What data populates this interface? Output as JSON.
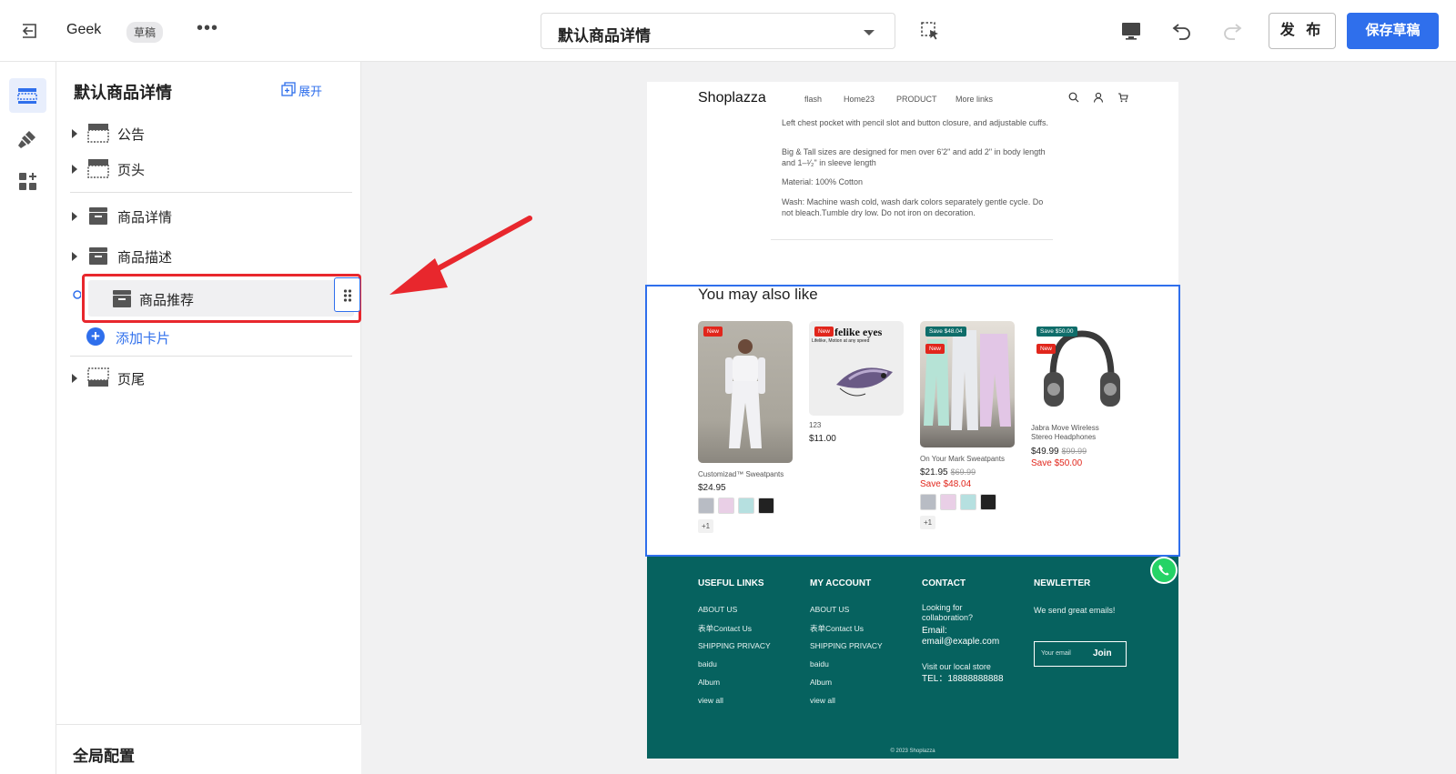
{
  "topbar": {
    "store_name": "Geek",
    "badge": "草稿",
    "more": "•••",
    "template_select": "默认商品详情",
    "publish_label": "发 布",
    "save_label": "保存草稿"
  },
  "panel": {
    "title": "默认商品详情",
    "expand_label": "展开",
    "sections": [
      {
        "label": "公告"
      },
      {
        "label": "页头"
      },
      {
        "label": "商品详情"
      },
      {
        "label": "商品描述"
      },
      {
        "label": "商品推荐"
      },
      {
        "label": "页尾"
      }
    ],
    "add_card_label": "添加卡片",
    "global_label": "全局配置"
  },
  "preview": {
    "logo": "Shoplazza",
    "nav": [
      "flash",
      "Home23",
      "PRODUCT",
      "More links"
    ],
    "description": [
      "Left chest pocket with pencil slot and button closure, and adjustable cuffs.",
      "Big & Tall sizes are designed for men over 6'2\" and add 2\" in body length and 1–¹⁄₂\" in sleeve length",
      "Material: 100% Cotton",
      "Wash: Machine wash cold, wash dark colors separately gentle cycle. Do not bleach.Tumble dry low. Do not iron on decoration."
    ],
    "rec_title": "You may also like",
    "products": [
      {
        "name": "Customizad™ Sweatpants",
        "price": "$24.95",
        "old_price": "",
        "save": "",
        "tag_new": "New",
        "tag_save": "",
        "more": "+1"
      },
      {
        "name": "123",
        "price": "$11.00",
        "old_price": "",
        "save": "",
        "tag_new": "New",
        "tag_save": "",
        "img_text": "felike eyes",
        "img_sub": "Lifelike, Motion at any speed",
        "more": ""
      },
      {
        "name": "On Your Mark Sweatpants",
        "price": "$21.95",
        "old_price": "$69.99",
        "save": "Save $48.04",
        "tag_new": "New",
        "tag_save": "Save $48.04",
        "more": "+1"
      },
      {
        "name": "Jabra Move Wireless Stereo Headphones",
        "price": "$49.99",
        "old_price": "$99.99",
        "save": "Save $50.00",
        "tag_new": "New",
        "tag_save": "Save $50.00",
        "more": ""
      }
    ],
    "footer": {
      "useful_links": {
        "title": "USEFUL LINKS",
        "items": [
          "ABOUT US",
          "表单Contact Us",
          "SHIPPING PRIVACY",
          "baidu",
          "Album",
          "view all"
        ]
      },
      "my_account": {
        "title": "MY ACCOUNT",
        "items": [
          "ABOUT US",
          "表单Contact Us",
          "SHIPPING PRIVACY",
          "baidu",
          "Album",
          "view all"
        ]
      },
      "contact": {
        "title": "CONTACT",
        "line1": "Looking for",
        "line2": "collaboration?",
        "email_label": "Email:",
        "email": "email@exaple.com",
        "visit": "Visit our local store",
        "tel": "TEL：18888888888"
      },
      "newsletter": {
        "title": "NEWLETTER",
        "text": "We send great emails!",
        "placeholder": "Your email",
        "join": "Join"
      },
      "copyright": "© 2023 Shoplazza"
    }
  },
  "colors": {
    "accent": "#2f6fec",
    "highlight": "#e8272d",
    "footer": "#06625f"
  }
}
